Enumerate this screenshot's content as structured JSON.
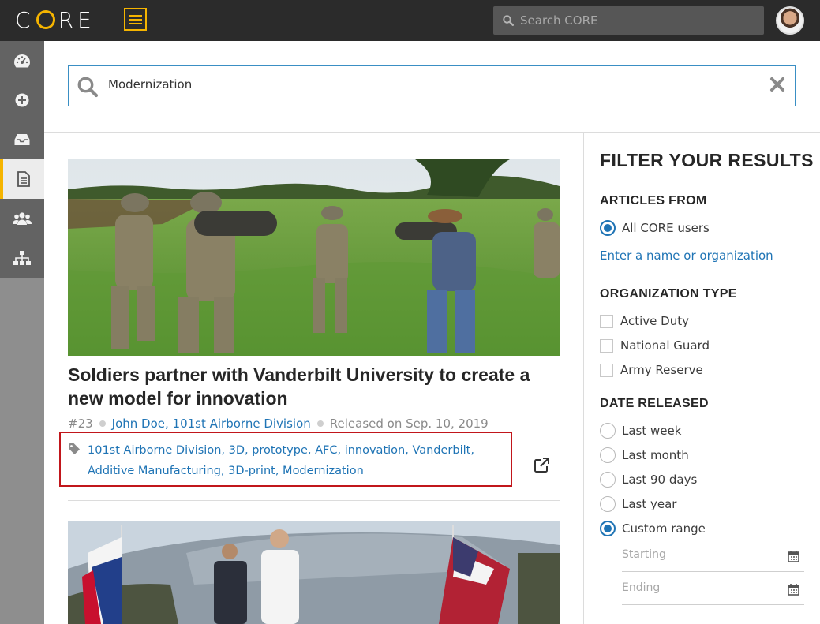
{
  "app": {
    "logo_text_c": "C",
    "logo_text_re": "RE",
    "logo_o": "O"
  },
  "header": {
    "search_placeholder": "Search CORE"
  },
  "sidebar": {
    "items": [
      {
        "icon": "dashboard-icon"
      },
      {
        "icon": "add-circle-icon"
      },
      {
        "icon": "inbox-icon"
      },
      {
        "icon": "document-icon",
        "active": true
      },
      {
        "icon": "users-icon"
      },
      {
        "icon": "org-chart-icon"
      }
    ]
  },
  "main_search": {
    "value": "Modernization"
  },
  "article": {
    "title": "Soldiers partner with Vanderbilt University to create a new model for innovation",
    "number": "#23",
    "author": "John Doe, 101st Airborne Division",
    "released": "Released on Sep. 10, 2019",
    "tags": "101st Airborne Division, 3D, prototype, AFC, innovation, Vanderbilt, Additive Manufacturing, 3D-print, Modernization"
  },
  "filters": {
    "title": "FILTER YOUR RESULTS",
    "articles_from": {
      "heading": "ARTICLES FROM",
      "option": "All CORE users",
      "link": "Enter a name or organization"
    },
    "org_type": {
      "heading": "ORGANIZATION TYPE",
      "options": [
        "Active Duty",
        "National Guard",
        "Army Reserve"
      ]
    },
    "date_released": {
      "heading": "DATE RELEASED",
      "options": [
        "Last week",
        "Last month",
        "Last 90 days",
        "Last year",
        "Custom range"
      ],
      "selected": "Custom range",
      "starting_placeholder": "Starting",
      "ending_placeholder": "Ending"
    }
  },
  "colors": {
    "accent": "#f5b400",
    "link": "#1f74b5",
    "highlight_box": "#c1161b",
    "topbar": "#2b2b2b"
  }
}
